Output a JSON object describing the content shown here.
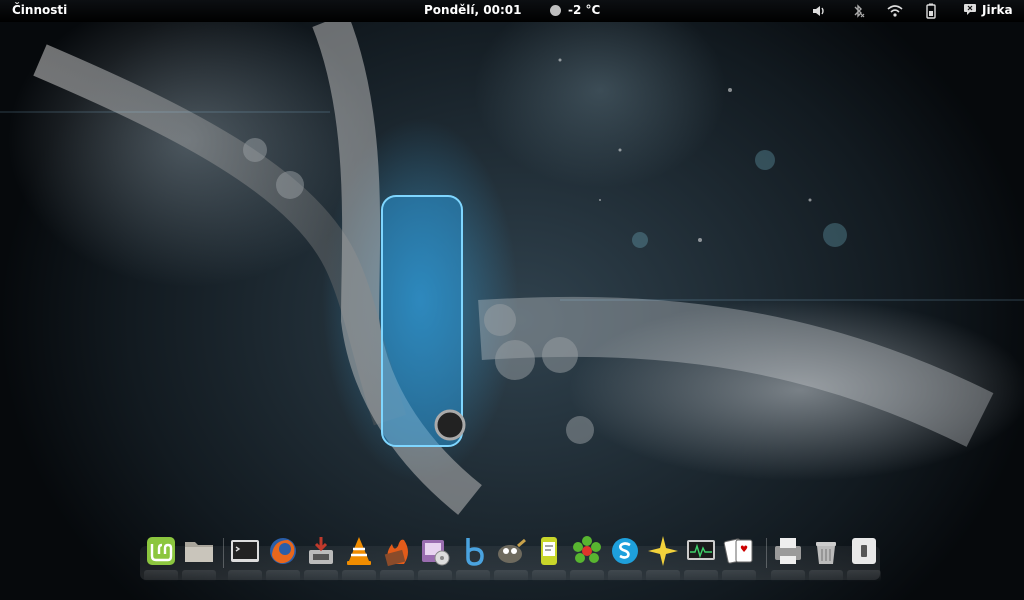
{
  "topbar": {
    "activities": "Činnosti",
    "clock": "Pondělí, 00:01",
    "weather_temp": "-2 °C",
    "user": "Jirka"
  },
  "tray": [
    "volume-icon",
    "bluetooth-icon",
    "wifi-icon",
    "battery-icon"
  ],
  "dock": {
    "items": [
      {
        "name": "linux-mint-menu",
        "icon": "mint-logo-icon"
      },
      {
        "name": "file-manager",
        "icon": "folder-icon"
      },
      {
        "name": "terminal",
        "icon": "terminal-icon"
      },
      {
        "name": "firefox",
        "icon": "firefox-icon"
      },
      {
        "name": "package-installer",
        "icon": "install-icon"
      },
      {
        "name": "vlc",
        "icon": "vlc-cone-icon"
      },
      {
        "name": "media-editor",
        "icon": "film-fire-icon"
      },
      {
        "name": "image-viewer",
        "icon": "photo-disc-icon"
      },
      {
        "name": "b-app",
        "icon": "b-swirl-icon"
      },
      {
        "name": "gimp",
        "icon": "gimp-icon"
      },
      {
        "name": "messenger",
        "icon": "chat-phone-icon"
      },
      {
        "name": "icq",
        "icon": "icq-flower-icon"
      },
      {
        "name": "skype",
        "icon": "skype-icon"
      },
      {
        "name": "favorites",
        "icon": "star-icon"
      },
      {
        "name": "system-monitor",
        "icon": "monitor-graph-icon"
      },
      {
        "name": "solitaire",
        "icon": "cards-icon"
      },
      {
        "name": "printer",
        "icon": "printer-icon"
      },
      {
        "name": "trash",
        "icon": "trash-icon"
      },
      {
        "name": "toggle-switch",
        "icon": "switch-icon"
      }
    ]
  }
}
